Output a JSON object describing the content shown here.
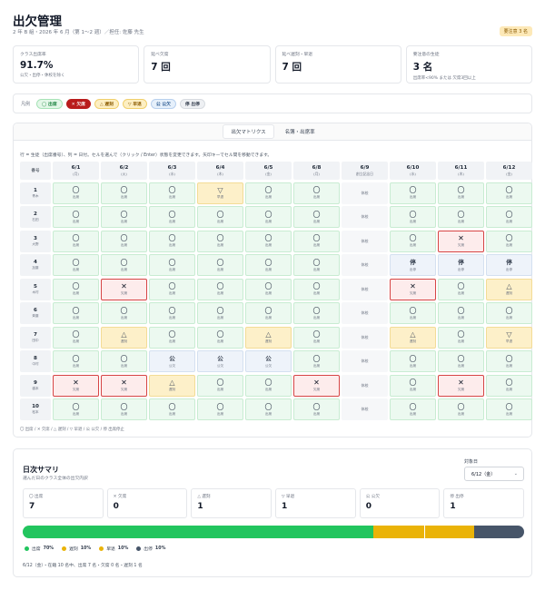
{
  "header": {
    "title": "出欠管理",
    "subtitle": "2 年 B 組・2026 年 6 月（第 1〜2 週）／担任: 佐藤 先生",
    "badge": "要注意 3 名"
  },
  "stats": [
    {
      "label": "クラス出席率",
      "value": "91.7%",
      "note": "公欠・出停・休校を除く"
    },
    {
      "label": "延べ欠席",
      "value": "7 回",
      "note": ""
    },
    {
      "label": "延べ遅刻・早退",
      "value": "7 回",
      "note": ""
    },
    {
      "label": "要注意の生徒",
      "value": "3 名",
      "note": "出席率<90% または 欠席3回以上"
    }
  ],
  "legend": {
    "title": "凡例",
    "chips": [
      {
        "kind": "present",
        "label": "◯ 出席"
      },
      {
        "kind": "absent",
        "label": "✕ 欠席"
      },
      {
        "kind": "late",
        "label": "△ 遅刻"
      },
      {
        "kind": "early",
        "label": "▽ 早退"
      },
      {
        "kind": "official",
        "label": "公 公欠"
      },
      {
        "kind": "suspended",
        "label": "停 出停"
      }
    ]
  },
  "tabs": [
    {
      "label": "出欠マトリクス",
      "active": true
    },
    {
      "label": "名簿・出席率",
      "active": false
    }
  ],
  "matrix": {
    "help": "行 = 生徒（出席番号）、列 = 日付。セルを選んで（クリック / Enter）状態を変更できます。矢印キーでセル間を移動できます。",
    "corner": "番号",
    "dates": [
      {
        "date": "6/1",
        "weekday": "(月)"
      },
      {
        "date": "6/2",
        "weekday": "(火)"
      },
      {
        "date": "6/3",
        "weekday": "(水)"
      },
      {
        "date": "6/4",
        "weekday": "(木)"
      },
      {
        "date": "6/5",
        "weekday": "(金)"
      },
      {
        "date": "6/8",
        "weekday": "(月)"
      },
      {
        "date": "6/9",
        "weekday": "創立記念日"
      },
      {
        "date": "6/10",
        "weekday": "(水)"
      },
      {
        "date": "6/11",
        "weekday": "(木)"
      },
      {
        "date": "6/12",
        "weekday": "(金)"
      }
    ],
    "students": [
      {
        "num": "1",
        "name": "青木"
      },
      {
        "num": "2",
        "name": "石田"
      },
      {
        "num": "3",
        "name": "大野"
      },
      {
        "num": "4",
        "name": "加藤"
      },
      {
        "num": "5",
        "name": "木村"
      },
      {
        "num": "6",
        "name": "斉藤"
      },
      {
        "num": "7",
        "name": "田中"
      },
      {
        "num": "8",
        "name": "中村"
      },
      {
        "num": "9",
        "name": "橋本"
      },
      {
        "num": "10",
        "name": "松本"
      }
    ],
    "symbols": {
      "present": "〇",
      "absent": "✕",
      "late": "△",
      "early": "▽",
      "official": "公",
      "suspended": "停",
      "rest": ""
    },
    "labels": {
      "present": "出席",
      "absent": "欠席",
      "late": "遅刻",
      "early": "早退",
      "official": "公欠",
      "suspended": "出停",
      "rest": "休校"
    },
    "rows": [
      [
        "present",
        "present",
        "present",
        "early",
        "present",
        "present",
        "rest",
        "present",
        "present",
        "present"
      ],
      [
        "present",
        "present",
        "present",
        "present",
        "present",
        "present",
        "rest",
        "present",
        "present",
        "present"
      ],
      [
        "present",
        "present",
        "present",
        "present",
        "present",
        "present",
        "rest",
        "present",
        "absent",
        "present"
      ],
      [
        "present",
        "present",
        "present",
        "present",
        "present",
        "present",
        "rest",
        "suspended",
        "suspended",
        "suspended"
      ],
      [
        "present",
        "absent",
        "present",
        "present",
        "present",
        "present",
        "rest",
        "absent",
        "present",
        "late"
      ],
      [
        "present",
        "present",
        "present",
        "present",
        "present",
        "present",
        "rest",
        "present",
        "present",
        "present"
      ],
      [
        "present",
        "late",
        "present",
        "present",
        "late",
        "present",
        "rest",
        "late",
        "present",
        "early"
      ],
      [
        "present",
        "present",
        "official",
        "official",
        "official",
        "present",
        "rest",
        "present",
        "present",
        "present"
      ],
      [
        "absent",
        "absent",
        "late",
        "present",
        "present",
        "absent",
        "rest",
        "present",
        "absent",
        "present"
      ],
      [
        "present",
        "present",
        "present",
        "present",
        "present",
        "present",
        "rest",
        "present",
        "present",
        "present"
      ]
    ],
    "legend_line": "〇 出席 / ✕ 欠席 / △ 遅刻 / ▽ 早退 / 公 公欠 / 停 出席停止"
  },
  "summary": {
    "title": "日次サマリ",
    "subtitle": "選んだ日のクラス全体の出欠内訳",
    "date_label": "対象日",
    "date_value": "6/12（金）",
    "counts": [
      {
        "label": "〇 出席",
        "value": "7"
      },
      {
        "label": "✕ 欠席",
        "value": "0"
      },
      {
        "label": "△ 遅刻",
        "value": "1"
      },
      {
        "label": "▽ 早退",
        "value": "1"
      },
      {
        "label": "公 公欠",
        "value": "0"
      },
      {
        "label": "停 出停",
        "value": "1"
      }
    ],
    "bar": [
      {
        "name": "出席",
        "pct_label": "70%",
        "value": 70,
        "color": "#22c55e"
      },
      {
        "name": "遅刻",
        "pct_label": "10%",
        "value": 10,
        "color": "#eab308"
      },
      {
        "name": "早退",
        "pct_label": "10%",
        "value": 10,
        "color": "#eab308"
      },
      {
        "name": "出停",
        "pct_label": "10%",
        "value": 10,
        "color": "#475569"
      }
    ],
    "footer": "6/12（金）・在籍 10 名中、出席 7 名・欠席 0 名・遅刻 1 名"
  }
}
